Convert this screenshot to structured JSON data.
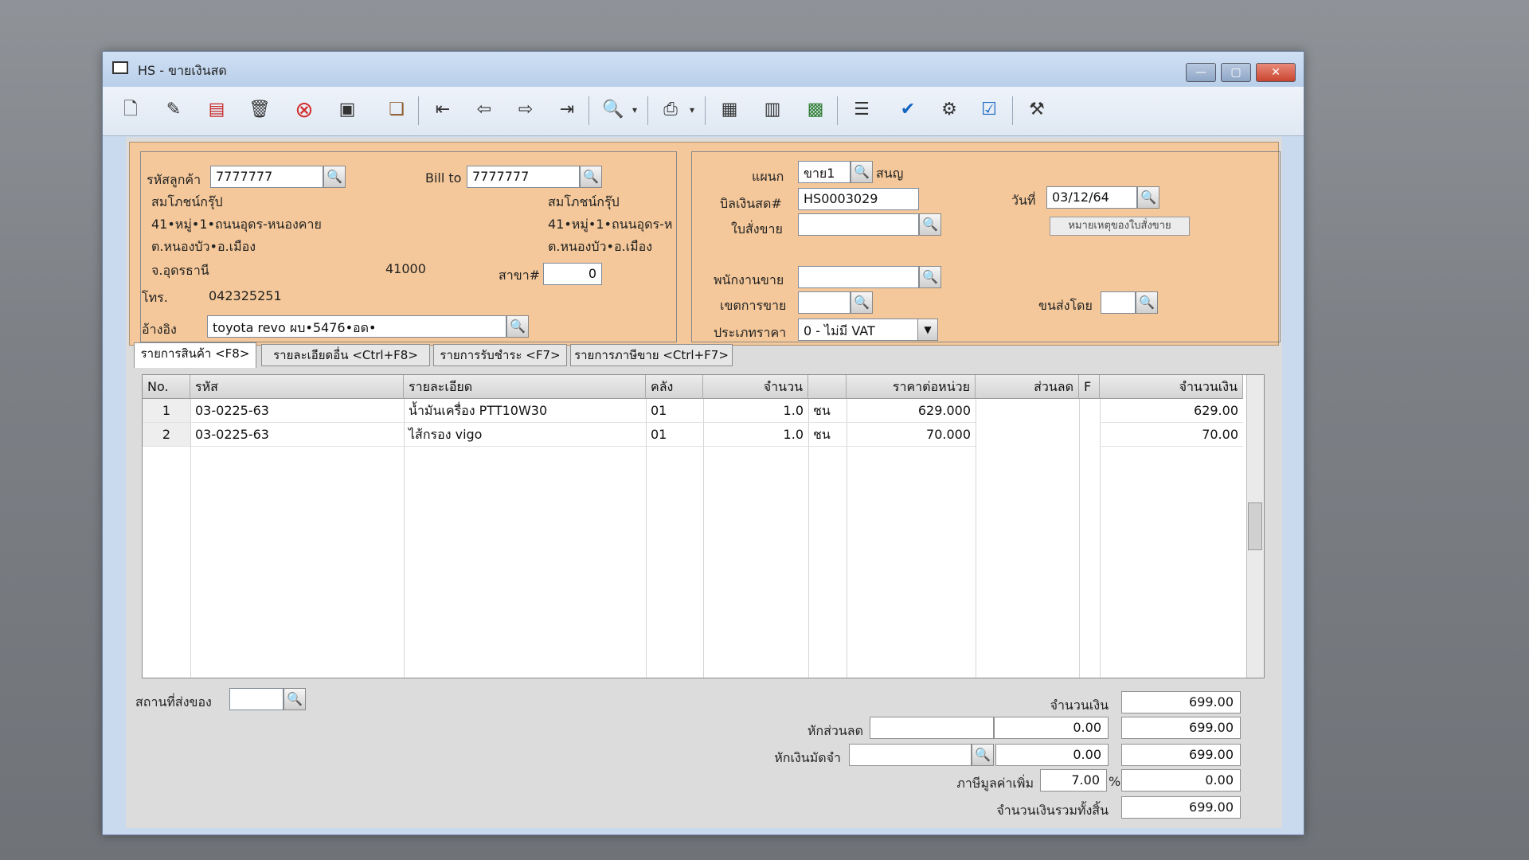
{
  "window": {
    "title": "HS - ขายเงินสด",
    "buttons": {
      "minimize": "—",
      "maximize": "▢",
      "close": "✕"
    }
  },
  "toolbar": {
    "icons": [
      "new-doc-icon",
      "edit-icon",
      "void-icon",
      "delete-icon",
      "cancel-icon",
      "save-icon",
      "copy-icon",
      "first-record-icon",
      "prev-record-icon",
      "next-record-icon",
      "last-record-icon",
      "search-icon",
      "print-icon",
      "calculator-icon",
      "form-icon",
      "stats-icon",
      "recalc-icon",
      "approve-icon",
      "tools-icon",
      "ok-icon",
      "settings-icon"
    ],
    "accent": "#d32f2f"
  },
  "customer": {
    "code_label": "รหัสลูกค้า",
    "code_value": "7777777",
    "name": "สมโภชน์กรุ๊ป",
    "addr1": "41•หมู่•1•ถนนอุดร-หนองคาย",
    "addr2": "ต.หนองบัว•อ.เมือง",
    "province": "จ.อุดรธานี",
    "zip": "41000",
    "tel_label": "โทร.",
    "tel_value": "042325251",
    "ref_label": "อ้างอิง",
    "ref_value": "toyota revo ผบ•5476•อด•"
  },
  "billto": {
    "label": "Bill to",
    "value": "7777777",
    "name": "สมโภชน์กรุ๊ป",
    "addr1": "41•หมู่•1•ถนนอุดร-ห",
    "addr2": "ต.หนองบัว•อ.เมือง",
    "branch_label": "สาขา#",
    "branch_value": "0"
  },
  "doc": {
    "dept_label": "แผนก",
    "dept_value": "ขาย1",
    "dept_name": "สนญ",
    "bill_label": "บิลเงินสด#",
    "bill_value": "HS0003029",
    "date_label": "วันที่",
    "date_value": "03/12/64",
    "so_label": "ใบสั่งขาย",
    "so_value": "",
    "so_note_button": "หมายเหตุของใบสั่งขาย",
    "sales_label": "พนักงานขาย",
    "sales_value": "",
    "area_label": "เขตการขาย",
    "area_value": "",
    "ship_label": "ขนส่งโดย",
    "ship_value": "",
    "price_type_label": "ประเภทราคา",
    "price_type_value": "0 - ไม่มี VAT"
  },
  "tabs": [
    {
      "label": "รายการสินค้า <F8>"
    },
    {
      "label": "รายละเอียดอื่น <Ctrl+F8>"
    },
    {
      "label": "รายการรับชำระ <F7>"
    },
    {
      "label": "รายการภาษีขาย <Ctrl+F7>"
    }
  ],
  "grid": {
    "headers": {
      "no": "No.",
      "code": "รหัส",
      "desc": "รายละเอียด",
      "wh": "คลัง",
      "qty": "จำนวน",
      "price": "ราคาต่อหน่วย",
      "disc": "ส่วนลด",
      "f": "F",
      "amount": "จำนวนเงิน"
    },
    "rows": [
      {
        "no": "1",
        "code": "03-0225-63",
        "desc": "น้ำมันเครื่อง PTT10W30",
        "wh": "01",
        "qty": "1.0",
        "unit": "ชน",
        "price": "629.000",
        "amount": "629.00"
      },
      {
        "no": "2",
        "code": "03-0225-63",
        "desc": "ไส้กรอง vigo",
        "wh": "01",
        "qty": "1.0",
        "unit": "ชน",
        "price": "70.000",
        "amount": "70.00"
      }
    ]
  },
  "footer": {
    "shipto_label": "สถานที่ส่งของ",
    "shipto_value": "",
    "amount_label": "จำนวนเงิน",
    "amount_value": "699.00",
    "discount_label": "หักส่วนลด",
    "discount_input": "",
    "discount_value": "0.00",
    "discount_after": "699.00",
    "deposit_label": "หักเงินมัดจำ",
    "deposit_input": "",
    "deposit_value": "0.00",
    "deposit_after": "699.00",
    "vat_label": "ภาษีมูลค่าเพิ่ม",
    "vat_rate": "7.00",
    "vat_pct": "%",
    "vat_value": "0.00",
    "total_label": "จำนวนเงินรวมทั้งสิ้น",
    "total_value": "699.00"
  }
}
